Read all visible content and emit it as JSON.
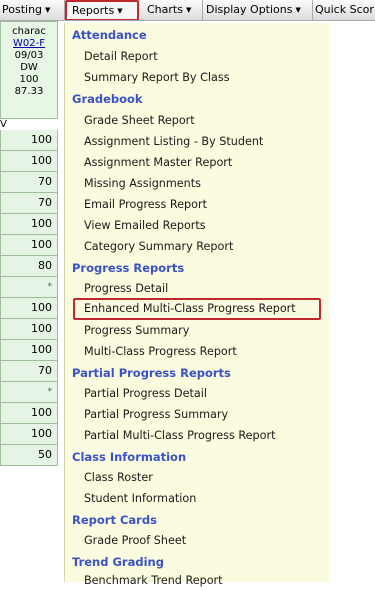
{
  "menubar": {
    "items": [
      {
        "label": "Posting"
      },
      {
        "label": "Reports"
      },
      {
        "label": "Charts"
      },
      {
        "label": "Display Options"
      },
      {
        "label": "Quick Scor"
      }
    ]
  },
  "assignment": {
    "name": "charac",
    "code": "W02-F",
    "code_next": "V",
    "date": "09/03",
    "type": "DW",
    "points": "100",
    "average": "87.33"
  },
  "scores": [
    "100",
    "100",
    "70",
    "70",
    "100",
    "100",
    "80",
    "*",
    "100",
    "100",
    "100",
    "70",
    "*",
    "100",
    "100",
    "50"
  ],
  "reports_menu": {
    "attendance": {
      "heading": "Attendance",
      "items": [
        "Detail Report",
        "Summary Report By Class"
      ]
    },
    "gradebook": {
      "heading": "Gradebook",
      "items": [
        "Grade Sheet Report",
        "Assignment Listing - By Student",
        "Assignment Master Report",
        "Missing Assignments",
        "Email Progress Report",
        "View Emailed Reports",
        "Category Summary Report"
      ]
    },
    "progress": {
      "heading": "Progress Reports",
      "items": [
        "Progress Detail",
        "Enhanced Multi-Class Progress Report",
        "Progress Summary",
        "Multi-Class Progress Report"
      ]
    },
    "partial": {
      "heading": "Partial Progress Reports",
      "items": [
        "Partial Progress Detail",
        "Partial Progress Summary",
        "Partial Multi-Class Progress Report"
      ]
    },
    "classinfo": {
      "heading": "Class Information",
      "items": [
        "Class Roster",
        "Student Information"
      ]
    },
    "reportcards": {
      "heading": "Report Cards",
      "items": [
        "Grade Proof Sheet"
      ]
    },
    "trend": {
      "heading": "Trend Grading",
      "items": [
        "Benchmark Trend Report"
      ]
    }
  }
}
